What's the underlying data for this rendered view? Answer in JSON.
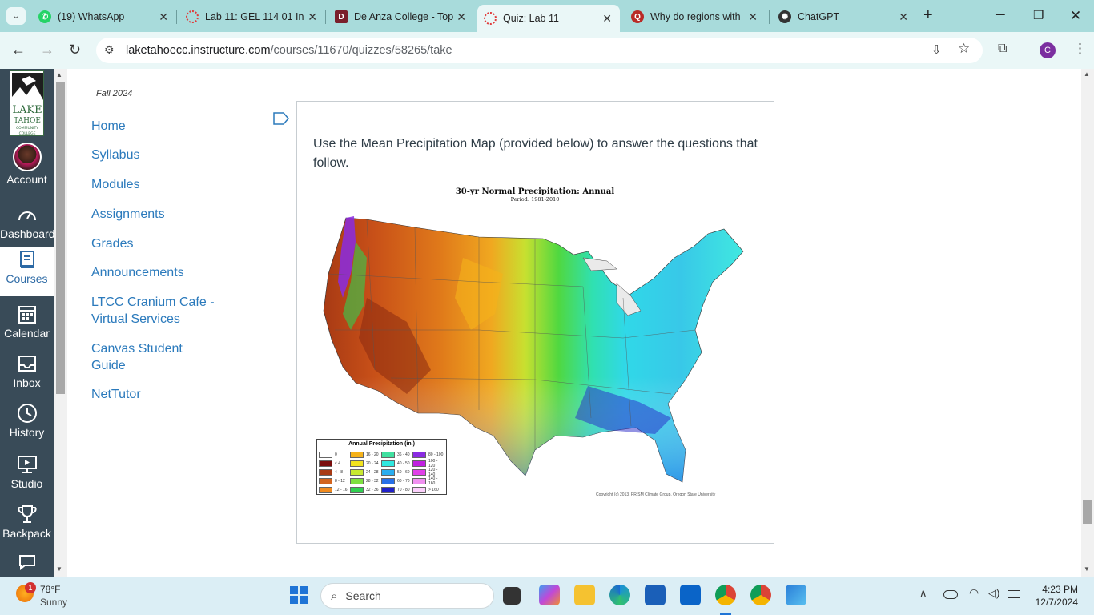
{
  "browser": {
    "tabs": [
      {
        "title": "(19) WhatsApp",
        "icon": "whatsapp-icon",
        "color": "#25d366"
      },
      {
        "title": "Lab 11: GEL 114 01 In",
        "icon": "canvas-icon",
        "color": "#e03a3a"
      },
      {
        "title": "De Anza College - Top",
        "icon": "deanza-icon",
        "color": "#7a1f2b"
      },
      {
        "title": "Quiz: Lab 11",
        "icon": "canvas-icon",
        "color": "#e03a3a",
        "active": true
      },
      {
        "title": "Why do regions with",
        "icon": "quora-icon",
        "color": "#b92b27"
      },
      {
        "title": "ChatGPT",
        "icon": "chatgpt-icon",
        "color": "#333333"
      }
    ],
    "url_host": "laketahoecc.instructure.com",
    "url_path": "/courses/11670/quizzes/58265/take",
    "profile_initial": "C"
  },
  "global_nav": {
    "items": [
      {
        "label": "Account",
        "icon": "account-avatar"
      },
      {
        "label": "Dashboard",
        "icon": "dashboard-icon"
      },
      {
        "label": "Courses",
        "icon": "courses-icon",
        "active": true
      },
      {
        "label": "Calendar",
        "icon": "calendar-icon"
      },
      {
        "label": "Inbox",
        "icon": "inbox-icon"
      },
      {
        "label": "History",
        "icon": "history-icon"
      },
      {
        "label": "Studio",
        "icon": "studio-icon"
      },
      {
        "label": "Backpack",
        "icon": "backpack-icon"
      }
    ],
    "logo_text": "LAKE TAHOE COMMUNITY COLLEGE"
  },
  "course_nav": {
    "term": "Fall 2024",
    "links": [
      "Home",
      "Syllabus",
      "Modules",
      "Assignments",
      "Grades",
      "Announcements",
      "LTCC Cranium Cafe - Virtual Services",
      "Canvas Student Guide",
      "NetTutor"
    ]
  },
  "question": {
    "text": "Use the Mean Precipitation Map (provided below) to answer the questions that follow."
  },
  "map": {
    "title": "30-yr Normal Precipitation: Annual",
    "subtitle": "Period: 1981-2010",
    "legend_title": "Annual Precipitation (in.)",
    "legend": [
      {
        "label": "0",
        "color": "#ffffff"
      },
      {
        "label": "16 - 20",
        "color": "#f5b21a"
      },
      {
        "label": "36 - 40",
        "color": "#40e0a0"
      },
      {
        "label": "80 - 100",
        "color": "#8a2be2"
      },
      {
        "label": "< 4",
        "color": "#7a0d0d"
      },
      {
        "label": "20 - 24",
        "color": "#f2e31f"
      },
      {
        "label": "40 - 50",
        "color": "#30e8e0"
      },
      {
        "label": "100 - 120",
        "color": "#c020e0"
      },
      {
        "label": "4 - 8",
        "color": "#a83a14"
      },
      {
        "label": "24 - 28",
        "color": "#c8e830"
      },
      {
        "label": "50 - 60",
        "color": "#2aaef0"
      },
      {
        "label": "120 - 140",
        "color": "#e040e8"
      },
      {
        "label": "8 - 12",
        "color": "#d2641e"
      },
      {
        "label": "28 - 32",
        "color": "#7ee040"
      },
      {
        "label": "60 - 70",
        "color": "#2870e8"
      },
      {
        "label": "140 - 160",
        "color": "#f090f0"
      },
      {
        "label": "12 - 16",
        "color": "#f08a1e"
      },
      {
        "label": "32 - 36",
        "color": "#30d050"
      },
      {
        "label": "70 - 80",
        "color": "#2020c8"
      },
      {
        "label": "> 160",
        "color": "#fcd0fc"
      }
    ],
    "copyright": "Copyright (c) 2013, PRISM Climate Group, Oregon State University"
  },
  "taskbar": {
    "weather_temp": "78°F",
    "weather_desc": "Sunny",
    "weather_badge": "1",
    "search_placeholder": "Search",
    "time": "4:23 PM",
    "date": "12/7/2024"
  }
}
